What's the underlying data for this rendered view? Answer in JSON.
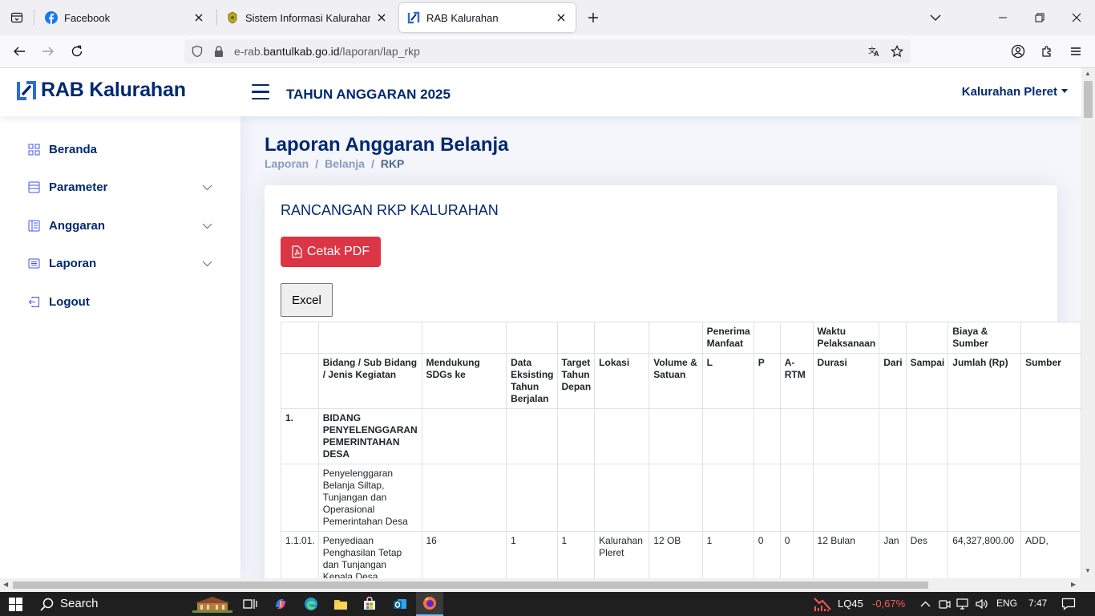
{
  "browser": {
    "tabs": [
      {
        "title": "Facebook",
        "active": false
      },
      {
        "title": "Sistem Informasi Kalurahan Pleret",
        "active": false
      },
      {
        "title": "RAB Kalurahan",
        "active": true
      }
    ],
    "url_prefix": "e-rab.",
    "url_domain": "bantulkab.go.id",
    "url_path": "/laporan/lap_rkp"
  },
  "header": {
    "brand": "RAB Kalurahan",
    "year_label": "TAHUN ANGGARAN 2025",
    "user_label": "Kalurahan Pleret"
  },
  "sidebar": {
    "items": [
      {
        "label": "Beranda",
        "icon": "grid-icon",
        "expandable": false
      },
      {
        "label": "Parameter",
        "icon": "layout-icon",
        "expandable": true
      },
      {
        "label": "Anggaran",
        "icon": "layout-text-icon",
        "expandable": true
      },
      {
        "label": "Laporan",
        "icon": "list-icon",
        "expandable": true
      },
      {
        "label": "Logout",
        "icon": "box-arrow-left-icon",
        "expandable": false
      }
    ]
  },
  "main": {
    "title": "Laporan Anggaran Belanja",
    "breadcrumb": [
      "Laporan",
      "Belanja",
      "RKP"
    ]
  },
  "card": {
    "title": "RANCANGAN RKP KALURAHAN",
    "pdf_button": "Cetak PDF",
    "excel_button": "Excel"
  },
  "table": {
    "group_headers": [
      "",
      "",
      "",
      "",
      "",
      "",
      "",
      "Penerima Manfaat",
      "",
      "",
      "Waktu Pelaksanaan",
      "",
      "",
      "Biaya & Sumber",
      ""
    ],
    "columns": [
      "",
      "Bidang / Sub Bidang / Jenis Kegiatan",
      "Mendukung SDGs ke",
      "Data Eksisting Tahun Berjalan",
      "Target Tahun Depan",
      "Lokasi",
      "Volume & Satuan",
      "L",
      "P",
      "A-RTM",
      "Durasi",
      "Dari",
      "Sampai",
      "Jumlah (Rp)",
      "Sumber"
    ],
    "rows": [
      [
        "1.",
        "BIDANG PENYELENGGARAN PEMERINTAHAN DESA",
        "",
        "",
        "",
        "",
        "",
        "",
        "",
        "",
        "",
        "",
        "",
        "",
        ""
      ],
      [
        "",
        "Penyelenggaran Belanja Siltap, Tunjangan dan Operasional Pemerintahan Desa",
        "",
        "",
        "",
        "",
        "",
        "",
        "",
        "",
        "",
        "",
        "",
        "",
        ""
      ],
      [
        "1.1.01.",
        "Penyediaan Penghasilan Tetap dan Tunjangan Kepala Desa",
        "16",
        "1",
        "1",
        "Kalurahan Pleret",
        "12 OB",
        "1",
        "0",
        "0",
        "12 Bulan",
        "Jan",
        "Des",
        "64,327,800.00",
        "ADD,"
      ]
    ]
  },
  "taskbar": {
    "search_label": "Search",
    "stock_name": "LQ45",
    "stock_change": "-0,67%",
    "language": "ENG",
    "time": "7:47"
  },
  "colors": {
    "brand": "#012970",
    "danger": "#dc3545",
    "stock_negative": "#ff5757",
    "page_bg": "#f4f6fb"
  }
}
